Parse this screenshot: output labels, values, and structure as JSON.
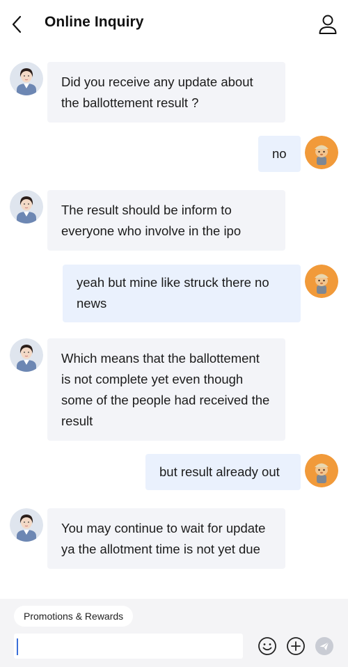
{
  "header": {
    "title": "Online Inquiry",
    "back_icon": "chevron-left-icon",
    "profile_icon": "user-icon"
  },
  "messages": [
    {
      "sender": "agent",
      "text": "Did you receive any update about the ballottement result ?"
    },
    {
      "sender": "user",
      "text": "no"
    },
    {
      "sender": "agent",
      "text": "The result should be inform to everyone who involve in the ipo"
    },
    {
      "sender": "user",
      "text": "yeah but mine like struck there no news"
    },
    {
      "sender": "agent",
      "text": "Which means that the ballottement is not complete yet even though some of the people had received the result"
    },
    {
      "sender": "user",
      "text": "but result already out"
    },
    {
      "sender": "agent",
      "text": "You may continue to wait for update ya the allotment time is not yet due"
    }
  ],
  "composer": {
    "quick_reply": "Promotions & Rewards",
    "input_value": "",
    "emoji_icon": "smiley-icon",
    "add_icon": "plus-circle-icon",
    "send_icon": "send-icon"
  },
  "colors": {
    "agent_bubble": "#f3f4f8",
    "user_bubble": "#eaf1fd",
    "composer_bg": "#f4f4f6",
    "user_avatar": "#f19a3a",
    "send_disabled": "#c9ccd4"
  }
}
